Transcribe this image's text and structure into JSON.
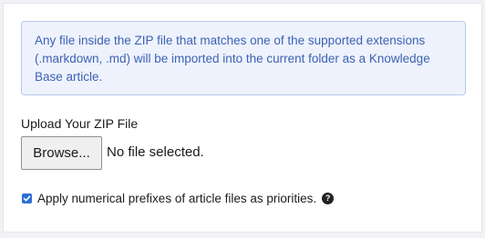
{
  "info": {
    "message": "Any file inside the ZIP file that matches one of the supported extensions (.markdown, .md) will be imported into the current folder as a Knowledge Base article."
  },
  "upload": {
    "label": "Upload Your ZIP File",
    "browse_label": "Browse...",
    "status": "No file selected."
  },
  "options": {
    "prefix_label": "Apply numerical prefixes of article files as priorities.",
    "prefix_checked": true,
    "help_glyph": "?"
  },
  "colors": {
    "accent": "#2b6fd6",
    "info_text": "#3c62b4",
    "info_bg": "#eef2fc"
  }
}
